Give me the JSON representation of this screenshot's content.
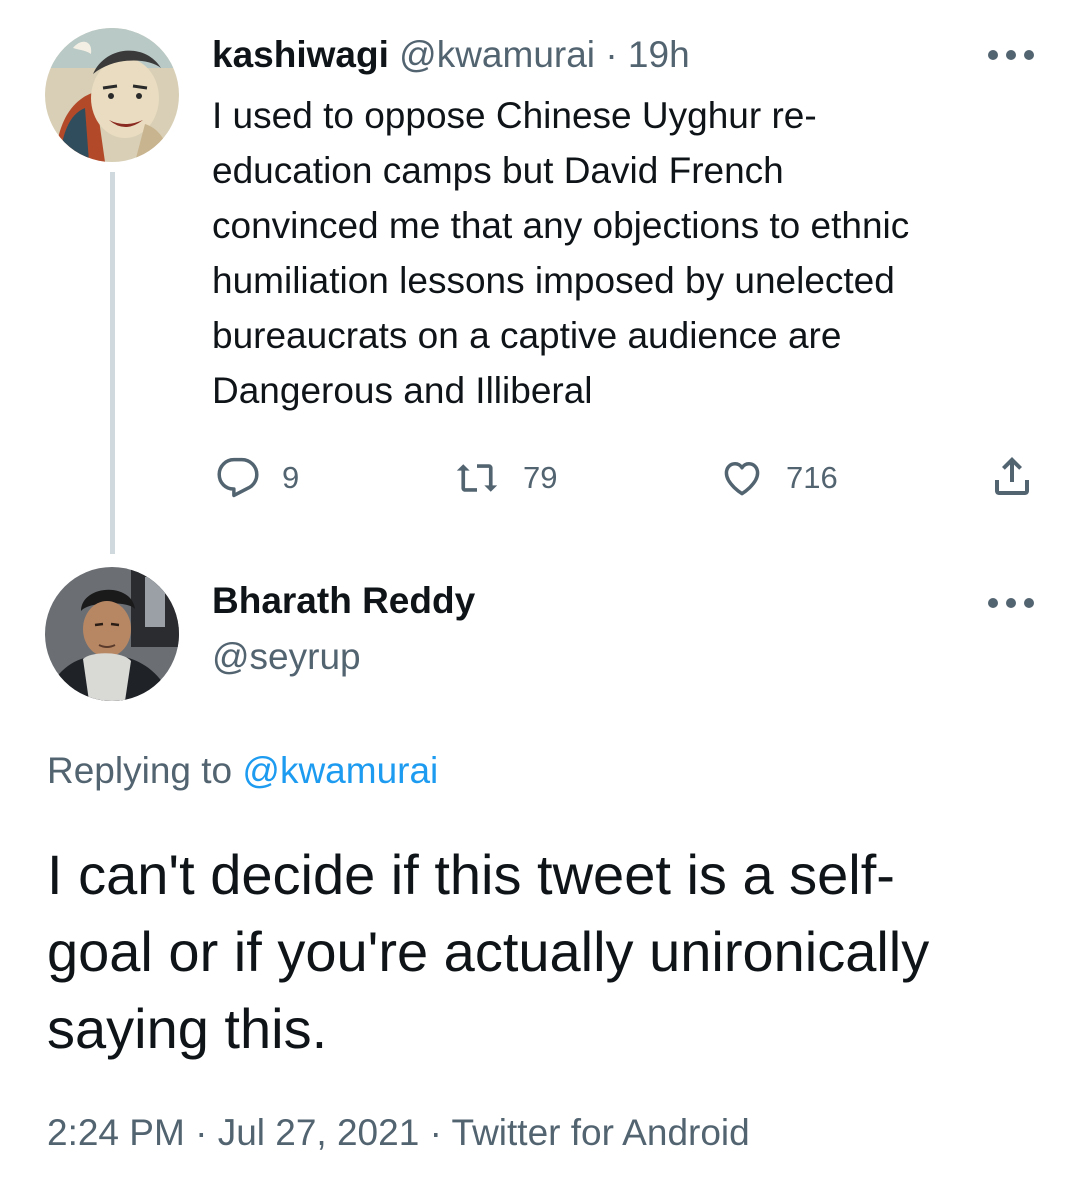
{
  "colors": {
    "text": "#0f1419",
    "secondary": "#536471",
    "link": "#1d9bf0",
    "thread_line": "#cfd9de"
  },
  "original_tweet": {
    "display_name": "kashiwagi",
    "handle": "@kwamurai",
    "separator": "·",
    "time": "19h",
    "text": "I used to oppose Chinese Uyghur re-education camps but David French convinced me that any objections to ethnic humiliation lessons imposed by unelected bureaucrats on a captive audience are Dangerous and Illiberal",
    "text_lines": [
      "I used to oppose Chinese Uyghur re-",
      "education camps but David French",
      "convinced me that any objections to ethnic",
      "humiliation lessons imposed by unelected",
      "bureaucrats on a captive audience are",
      "Dangerous and Illiberal"
    ],
    "actions": {
      "reply_icon": "reply-icon",
      "reply_count": "9",
      "retweet_icon": "retweet-icon",
      "retweet_count": "79",
      "like_icon": "heart-icon",
      "like_count": "716",
      "share_icon": "share-icon"
    },
    "more_icon": "more-dots-icon"
  },
  "reply_tweet": {
    "display_name": "Bharath Reddy",
    "handle": "@seyrup",
    "replying_prefix": "Replying to",
    "replying_to": "@kwamurai",
    "text": "I can't decide if this tweet is a self-goal or if you're actually unironically saying this.",
    "text_lines": [
      "I can't decide if this tweet is a self-",
      "goal or if you're actually unironically",
      "saying this."
    ],
    "time": "2:24 PM",
    "separator": "·",
    "date": "Jul 27, 2021",
    "source": "Twitter for Android",
    "more_icon": "more-dots-icon"
  }
}
